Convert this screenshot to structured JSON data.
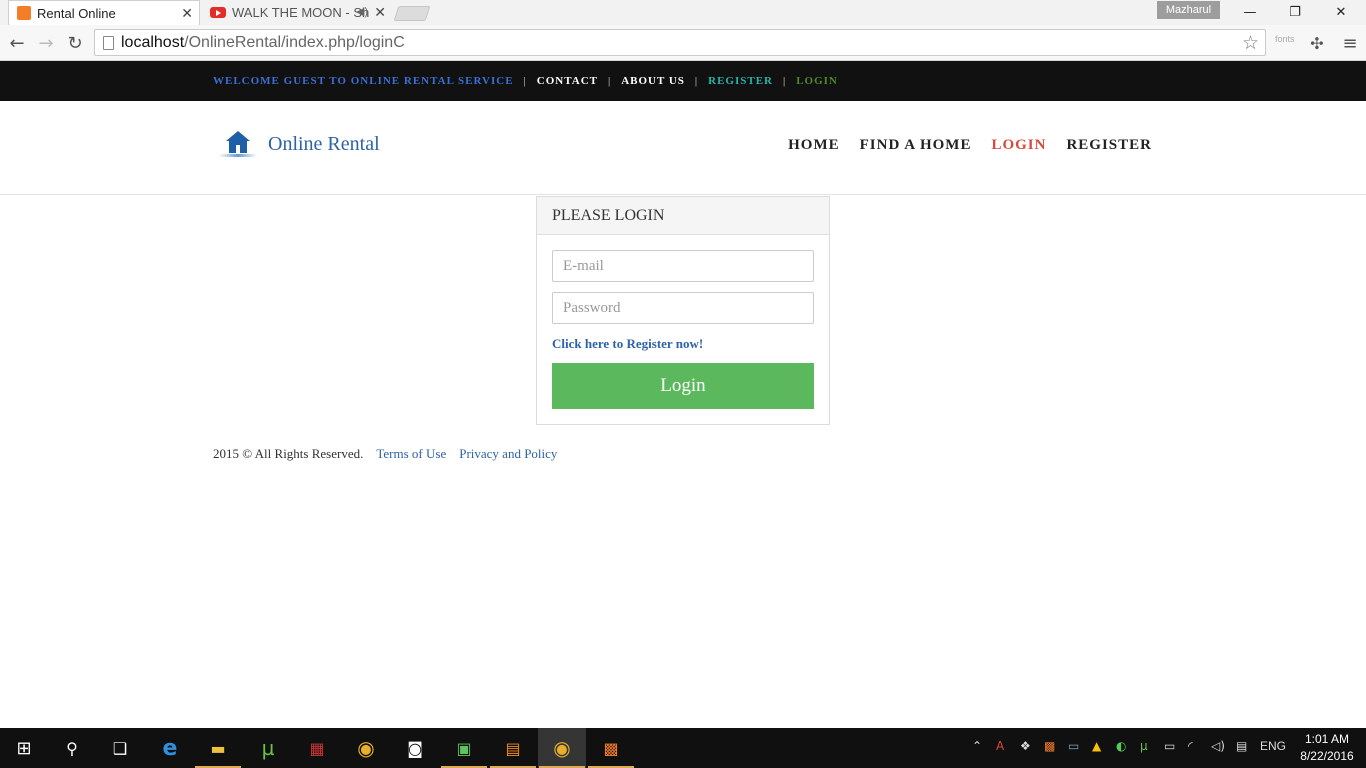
{
  "browser": {
    "tabs": [
      {
        "title": "Rental Online",
        "favicon": "xampp-icon"
      },
      {
        "title": "WALK THE MOON - Sh",
        "favicon": "youtube-icon"
      }
    ],
    "profile_name": "Mazharul",
    "url_host": "localhost",
    "url_path": "/OnlineRental/index.php/loginC",
    "extension_label": "fonts"
  },
  "topbar": {
    "welcome": "WELCOME GUEST TO ONLINE RENTAL SERVICE",
    "contact": "CONTACT",
    "about": "ABOUT US",
    "register": "REGISTER",
    "login": "LOGIN"
  },
  "header": {
    "brand": "Online Rental",
    "nav": [
      "HOME",
      "FIND A HOME",
      "LOGIN",
      "REGISTER"
    ]
  },
  "login_panel": {
    "title": "PLEASE LOGIN",
    "email_placeholder": "E-mail",
    "password_placeholder": "Password",
    "register_link": "Click here to Register now!",
    "login_button": "Login"
  },
  "footer": {
    "copyright": "2015 © All Rights Reserved.",
    "terms": "Terms of Use",
    "privacy": "Privacy and Policy"
  },
  "taskbar": {
    "language": "ENG",
    "time": "1:01 AM",
    "date": "8/22/2016"
  },
  "colors": {
    "accent_green": "#5cb85c",
    "link_blue": "#2e63a6",
    "active_nav_red": "#d9493f",
    "topbar_bg": "#111111"
  }
}
